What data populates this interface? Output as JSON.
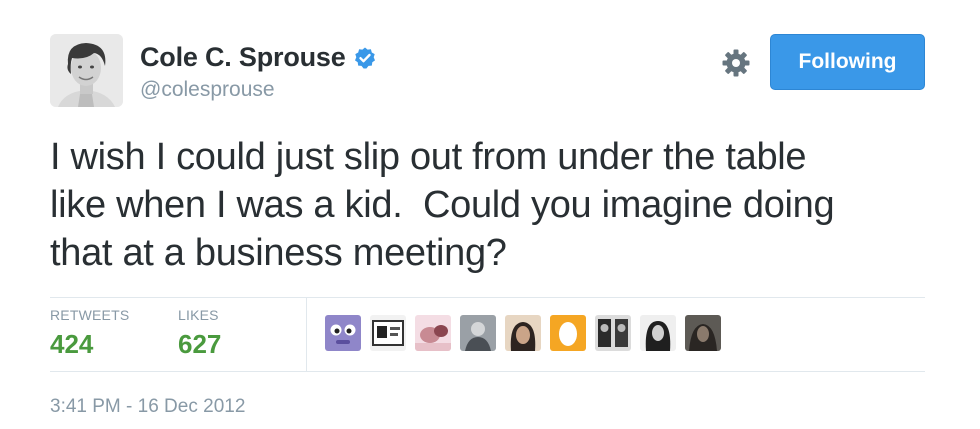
{
  "user": {
    "name": "Cole C. Sprouse",
    "handle": "@colesprouse",
    "verified": true
  },
  "actions": {
    "follow_label": "Following",
    "settings_icon": "gear-icon",
    "accent_color": "#3a98e8"
  },
  "tweet": {
    "text": "I wish I could just slip out from under the table\nlike when I was a kid.  Could you imagine doing\nthat at a business meeting?"
  },
  "stats": {
    "retweets_label": "RETWEETS",
    "retweets_value": "424",
    "likes_label": "LIKES",
    "likes_value": "627",
    "value_color": "#4a9a3e"
  },
  "likers": [
    {
      "icon": "avatar-purple-monster"
    },
    {
      "icon": "avatar-bw-sticker"
    },
    {
      "icon": "avatar-pink-face"
    },
    {
      "icon": "avatar-gray-photo"
    },
    {
      "icon": "avatar-dark-hair"
    },
    {
      "icon": "avatar-orange-egg"
    },
    {
      "icon": "avatar-bw-couple"
    },
    {
      "icon": "avatar-bw-portrait"
    },
    {
      "icon": "avatar-dark-portrait"
    }
  ],
  "timestamp": "3:41 PM - 16 Dec 2012"
}
